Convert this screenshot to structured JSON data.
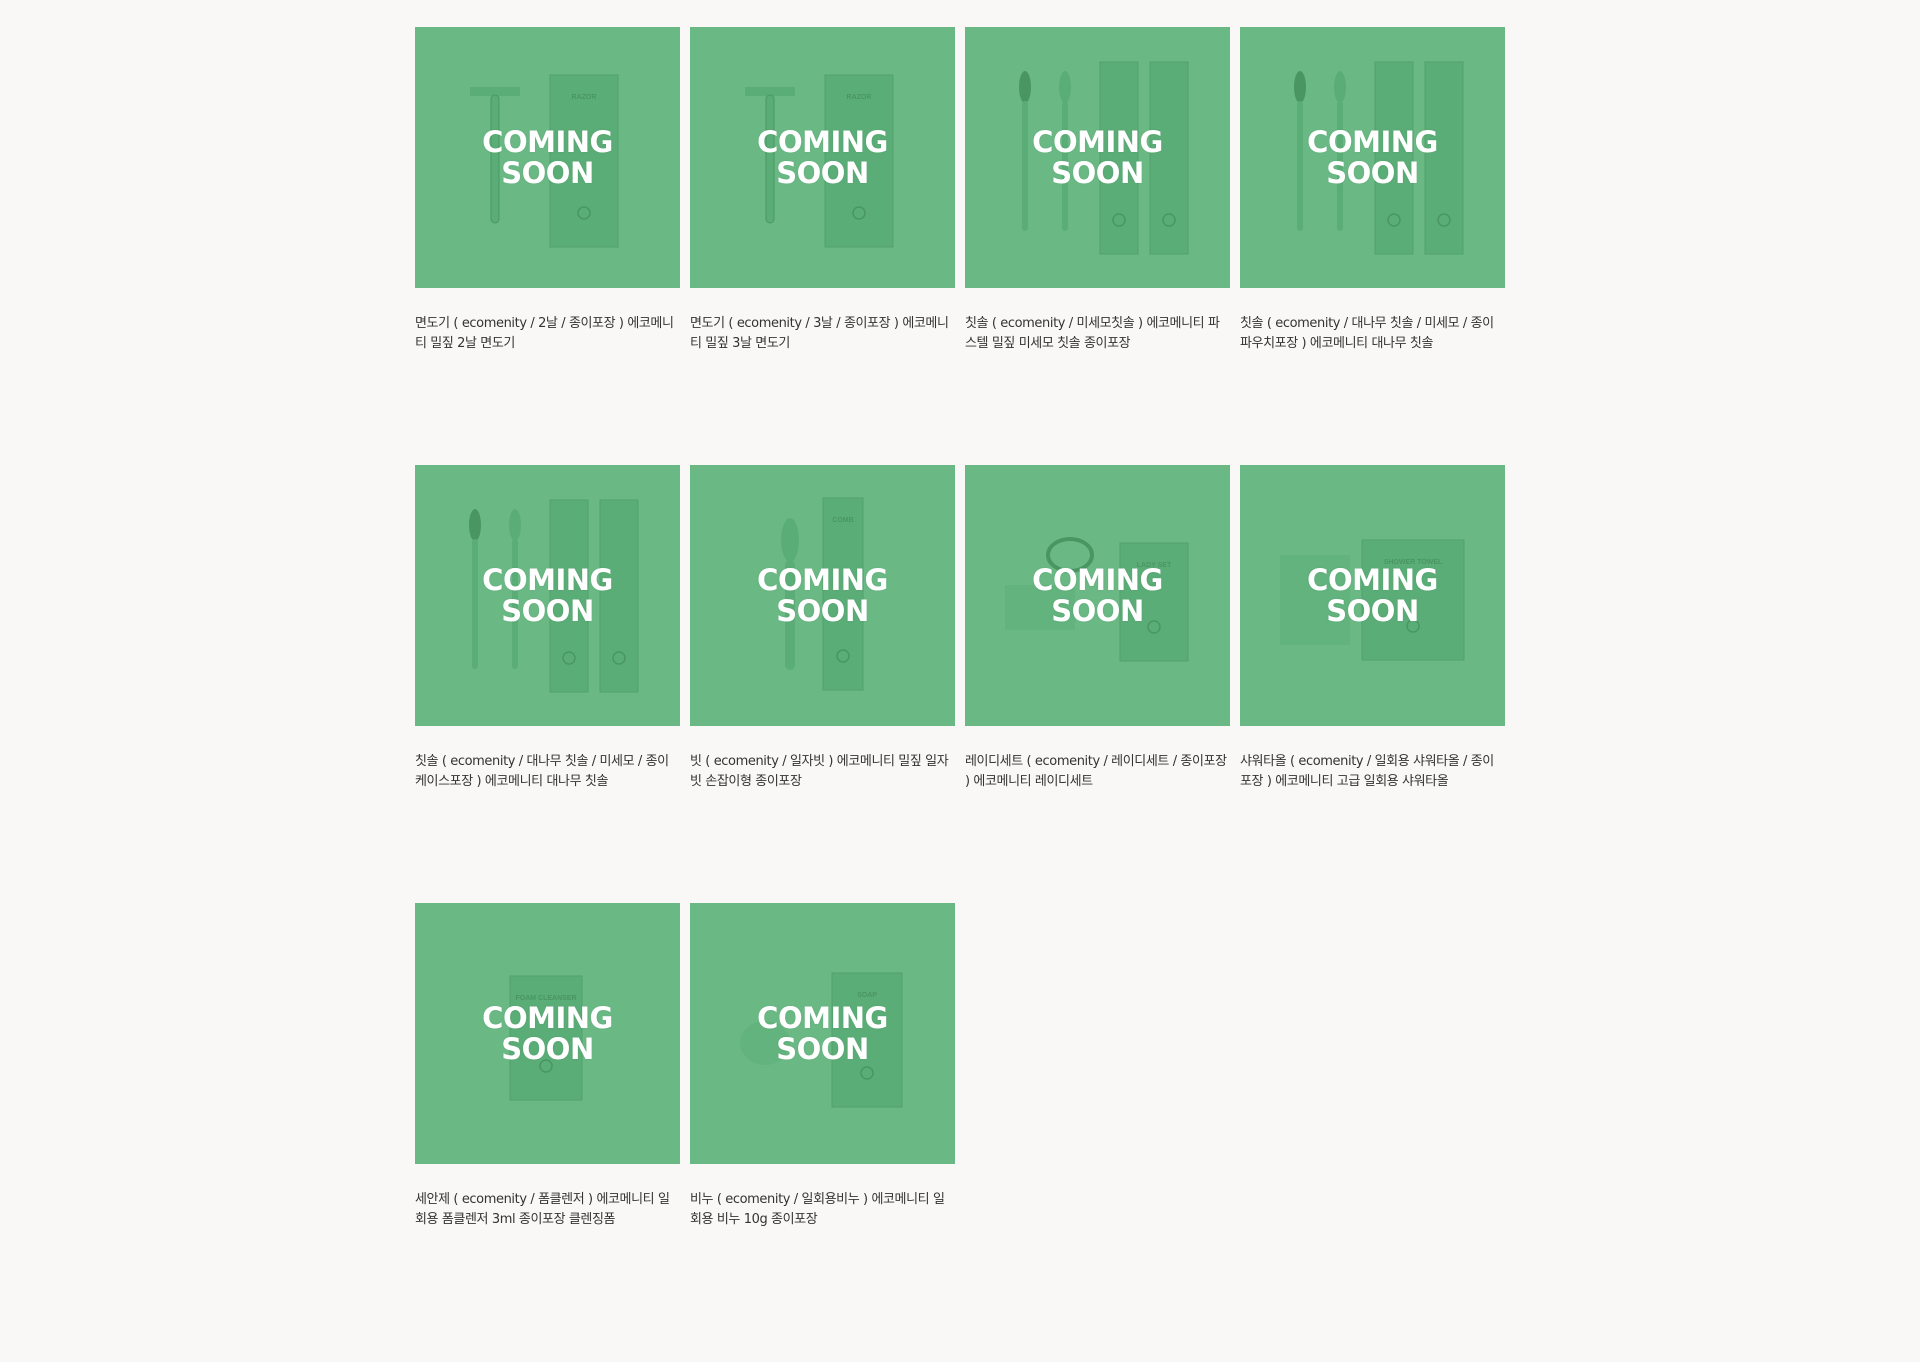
{
  "badge": {
    "line1": "COMING",
    "line2": "SOON",
    "overlay_color": "#6ab985"
  },
  "products": [
    {
      "title": "면도기 ( ecomenity / 2날 / 종이포장 ) 에코메니티 밀짚 2날 면도기",
      "art": "razor",
      "pack_label": "RAZOR"
    },
    {
      "title": "면도기 ( ecomenity / 3날 / 종이포장 ) 에코메니티 밀짚 3날 면도기",
      "art": "razor",
      "pack_label": "RAZOR"
    },
    {
      "title": "칫솔 ( ecomenity / 미세모칫솔 ) 에코메니티 파스텔 밀짚 미세모 칫솔 종이포장",
      "art": "toothbrush-pair",
      "pack_label": ""
    },
    {
      "title": "칫솔 ( ecomenity / 대나무 칫솔 / 미세모 / 종이파우치포장 ) 에코메니티 대나무 칫솔",
      "art": "toothbrush-pair",
      "pack_label": ""
    },
    {
      "title": "칫솔 ( ecomenity / 대나무 칫솔 / 미세모 / 종이케이스포장 ) 에코메니티 대나무 칫솔",
      "art": "toothbrush-pair",
      "pack_label": ""
    },
    {
      "title": "빗 ( ecomenity / 일자빗 ) 에코메니티 밀짚 일자빗 손잡이형 종이포장",
      "art": "comb",
      "pack_label": "COMB"
    },
    {
      "title": "레이디세트 ( ecomenity / 레이디세트 / 종이포장 ) 에코메니티 레이디세트",
      "art": "lady-set",
      "pack_label": "LADY SET"
    },
    {
      "title": "샤워타올 ( ecomenity / 일회용 샤워타올 / 종이포장 ) 에코메니티 고급 일회용 샤워타올",
      "art": "shower-towel",
      "pack_label": "SHOWER TOWEL"
    },
    {
      "title": "세안제 ( ecomenity / 폼클렌저 ) 에코메니티 일회용 폼클렌저 3ml 종이포장 클렌징폼",
      "art": "foam",
      "pack_label": "FOAM CLEANSER"
    },
    {
      "title": "비누 ( ecomenity / 일회용비누 ) 에코메니티 일회용 비누 10g 종이포장",
      "art": "soap",
      "pack_label": "SOAP"
    }
  ]
}
